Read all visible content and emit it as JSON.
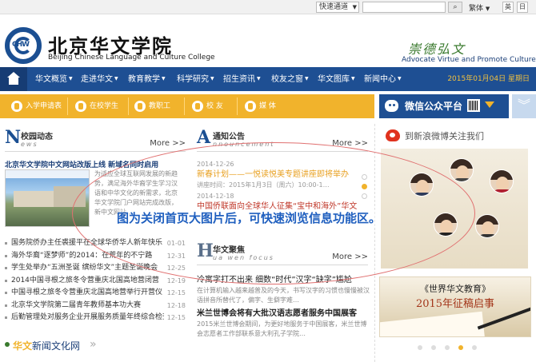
{
  "topbar": {
    "quick_select": "快速通道",
    "search_placeholder": "",
    "search_button": "搜",
    "version_select": "繁体",
    "btn_a": "英",
    "btn_b": "日"
  },
  "header": {
    "logo_text": "CHW",
    "cn_name": "北京华文学院",
    "en_name": "Beijing Chinese Language and Culture College",
    "motto_cn": "崇德弘文",
    "motto_en": "Advocate Virtue and Promote Culture"
  },
  "nav": {
    "items": [
      "华文概览",
      "走进华文",
      "教育教学",
      "科学研究",
      "招生资讯",
      "校友之窗",
      "华文图库",
      "新闻中心"
    ],
    "date": "2015年01月04日 星期日"
  },
  "quicklinks": [
    "入学申请表",
    "在校学生",
    "教职工",
    "校 友",
    "媒 体"
  ],
  "wechat": {
    "label": "微信公众平台"
  },
  "campus_news": {
    "big": "N",
    "cn": "校园动态",
    "en": "ews",
    "more": "More >>",
    "feature_title": "北京华文学院中文网站改版上线  新域名同时启用",
    "feature_text": "为适应全球互联网发展的新趋势，满足海外华裔学生学习汉语和中华文化的新需求，北京华文学院门户网站完成改版，新中文网站…",
    "items": [
      {
        "title": "国务院侨办主任裘援平在全球华侨华人新年快乐",
        "date": "01-01"
      },
      {
        "title": "海外华裔“逐梦师”的2014：在荒年的不宁路",
        "date": "12-31"
      },
      {
        "title": "学生处举办“五洲圣诞 缤纷华文”主题圣诞晚会",
        "date": "12-25"
      },
      {
        "title": "2014中国寻根之旅冬令营重庆北国高地营闭营",
        "date": "12-19"
      },
      {
        "title": "中国寻根之旅冬令营重庆北国高地营举行开营仪",
        "date": "12-15"
      },
      {
        "title": "北京华文学院第二届青年教师基本功大赛",
        "date": "12-18"
      },
      {
        "title": "后勤管理处对服务企业开展服务质量年终综合检查",
        "date": "12-15"
      }
    ]
  },
  "wenhua": {
    "prefix": "华文",
    "rest": "新闻文化网"
  },
  "notice": {
    "big": "A",
    "cn": "通知公告",
    "en": "nnouncement",
    "more": "More >>",
    "items": [
      {
        "date": "2014-12-26",
        "title": "新春计划——一悦读悦美专题讲座即将举办",
        "meta": "讲座时间：2015年1月3日（周六）10:00-1…"
      },
      {
        "date": "2014-12-18",
        "title": "中国侨联面向全球华人征集“宝中和海外”华文",
        "meta": ""
      }
    ]
  },
  "huawen": {
    "big": "H",
    "cn": "华文聚焦",
    "en": "ua wen focus",
    "more": "More >>",
    "items": [
      {
        "title": "冷寓字打不出来 细数“时代”汉字“缺字”尴尬",
        "desc": "在计算机输入越来越普及的今天，书写汉字的习惯也慢慢被汉语拼音所替代了，偏字、生僻字难…"
      },
      {
        "title": "米兰世博会将有大批汉语志愿者服务中国展客",
        "desc": "2015米兰世博会期间，为更好地服务于中国展客，米兰世博会志愿者工作部联系意大利孔子学院…"
      }
    ]
  },
  "weibo": {
    "label": "到新浪微博关注我们"
  },
  "banner": {
    "line1": "《世界华文教育》",
    "line2": "2015年征稿启事"
  },
  "annotation": "图为关闭首页大图片后，可快速浏览信息功能区。"
}
